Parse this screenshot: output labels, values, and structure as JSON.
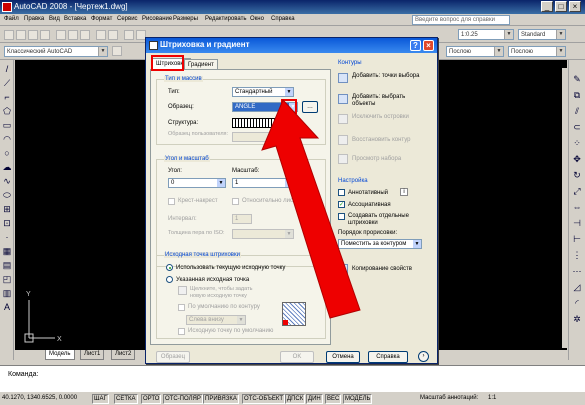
{
  "app": {
    "title": "AutoCAD 2008 - [Чертеж1.dwg]",
    "menu": [
      "Файл",
      "Правка",
      "Вид",
      "Вставка",
      "Формат",
      "Сервис",
      "Рисование",
      "Размеры",
      "Редактировать",
      "Окно",
      "Справка"
    ],
    "help_placeholder": "Введите вопрос для справки",
    "workspace_combo": "Классический AutoCAD",
    "textstyle_combo": "Standard",
    "scale_combo": "1:0.25",
    "layer_combo": "Послою",
    "layer_combo2": "Послою",
    "layout_tabs": [
      "Модель",
      "Лист1",
      "Лист2"
    ],
    "command_prompt": "Команда:",
    "coords": "40.1270, 1340.6525, 0.0000",
    "status_buttons": [
      "ШАГ",
      "СЕТКА",
      "ОРТО",
      "ОТС-ПОЛЯР",
      "ПРИВЯЗКА",
      "ОТС-ОБЪЕКТ",
      "ДПСК",
      "ДИН",
      "ВЕС",
      "МОДЕЛЬ"
    ],
    "annot_scale_label": "Масштаб аннотаций:",
    "annot_scale_value": "1:1"
  },
  "dialog": {
    "title": "Штриховка и градиент",
    "tabs": [
      "Штриховка",
      "Градиент"
    ],
    "group_type": "Тип и массив",
    "label_type": "Тип:",
    "value_type": "Стандартный",
    "label_pattern": "Образец:",
    "value_pattern": "ANGLE",
    "label_swatch": "Структура:",
    "label_custom": "Образец пользователя:",
    "group_angle": "Угол и масштаб",
    "label_angle": "Угол:",
    "value_angle": "0",
    "label_scale": "Масштаб:",
    "value_scale": "1",
    "check_double": "Крест-накрест",
    "check_relative": "Относительно листа",
    "label_spacing": "Интервал:",
    "value_spacing": "1",
    "label_iso": "Толщина пера по ISO:",
    "group_origin": "Исходная точка штриховки",
    "radio_current": "Использовать текущую исходную точку",
    "radio_specified": "Указанная исходная точка",
    "click_set": "Щелкните, чтобы задать новую исходную точку",
    "check_default_extents": "По умолчанию по контуру",
    "value_extents": "Слева внизу",
    "check_store": "Исходную точку по умолчанию",
    "group_boundaries": "Контуры",
    "btn_add_pick": "Добавить: точки выбора",
    "btn_add_select": "Добавить: выбрать объекты",
    "btn_remove": "Исключить островки",
    "btn_recreate": "Восстановить контур",
    "btn_view": "Просмотр набора",
    "group_options": "Настройка",
    "check_annotative": "Аннотативный",
    "check_associative": "Ассоциативная",
    "check_separate": "Создавать отдельные штриховки",
    "label_draw_order": "Порядок прорисовки:",
    "value_draw_order": "Поместить за контуром",
    "btn_inherit": "Копирование свойств",
    "btn_preview": "Образец",
    "btn_ok": "OK",
    "btn_cancel": "Отмена",
    "btn_help": "Справка"
  },
  "colors": {
    "annotation_red": "#ee0000",
    "drawing_bg": "#000000",
    "dialog_bg": "#ece9d8"
  }
}
